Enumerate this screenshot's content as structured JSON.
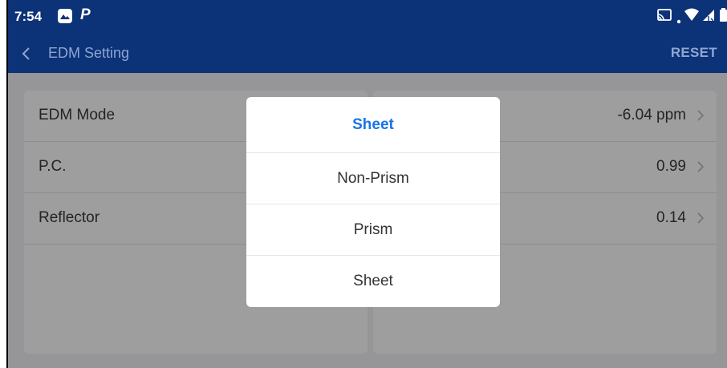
{
  "status_bar": {
    "time": "7:54",
    "left_icons": [
      "gallery-icon",
      "parking-p-icon"
    ],
    "right_icons": [
      "cast-icon",
      "dot-icon",
      "wifi-icon",
      "signal-icon",
      "battery-icon"
    ]
  },
  "app_bar": {
    "title": "EDM Setting",
    "action_label": "RESET"
  },
  "settings": {
    "rows": [
      {
        "label": "EDM Mode",
        "value": "-6.04 ppm"
      },
      {
        "label": "P.C.",
        "value": "0.99"
      },
      {
        "label": "Reflector",
        "value": "0.14"
      }
    ]
  },
  "dialog": {
    "title": "Sheet",
    "options": [
      "Non-Prism",
      "Prism",
      "Sheet"
    ]
  },
  "colors": {
    "header_bg": "#0c3277",
    "accent": "#1a73e8",
    "scrim": "rgba(0,0,0,0.38)"
  }
}
